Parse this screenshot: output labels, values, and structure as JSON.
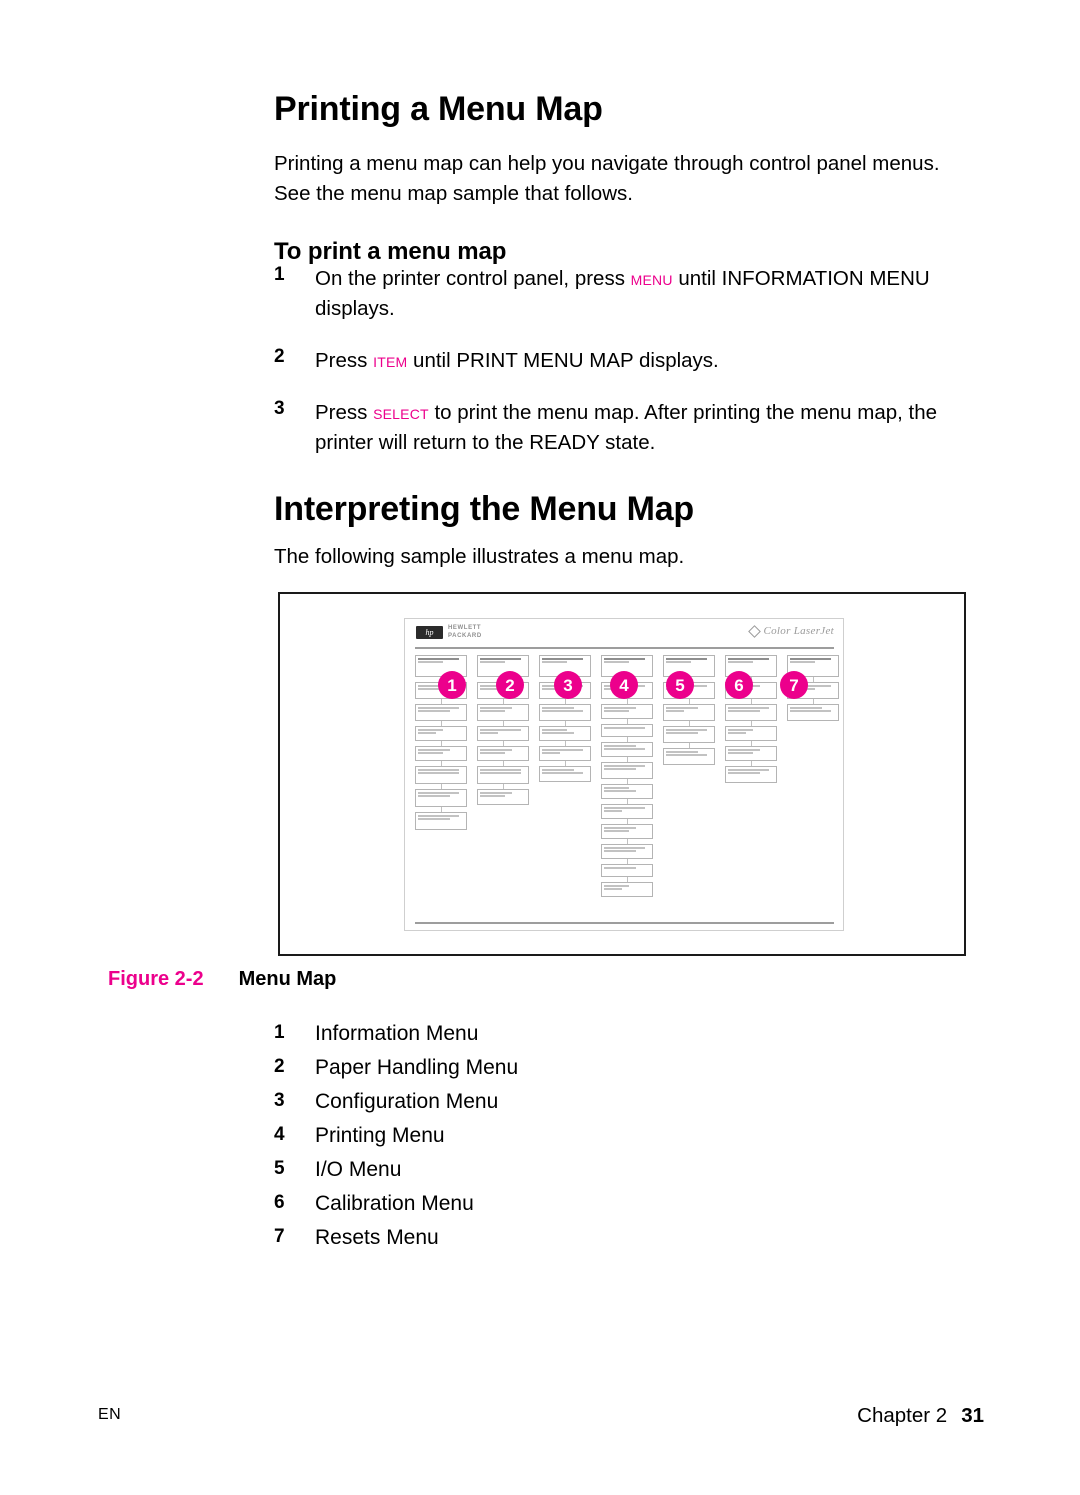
{
  "document": {
    "section1": {
      "heading": "Printing a Menu Map",
      "intro": "Printing a menu map can help you navigate through control panel menus. See the menu map sample that follows.",
      "subheading": "To print a menu map",
      "steps": [
        {
          "num": "1",
          "pre": "On the printer control panel, press ",
          "key": "MENU",
          "post": " until INFORMATION MENU displays."
        },
        {
          "num": "2",
          "pre": "Press ",
          "key": "ITEM",
          "post": " until PRINT MENU MAP displays."
        },
        {
          "num": "3",
          "pre": "Press ",
          "key": "SELECT",
          "post": " to print the menu map. After printing the menu map, the printer will return to the READY state."
        }
      ]
    },
    "section2": {
      "heading": "Interpreting the Menu Map",
      "intro": "The following sample illustrates a menu map."
    },
    "figure": {
      "number": "Figure 2-2",
      "title": "Menu Map",
      "sample_page": {
        "brand_logo": "hp-logo",
        "brand_text": "HEWLETT\nPACKARD",
        "product_mark": "Color LaserJet",
        "callouts": [
          "1",
          "2",
          "3",
          "4",
          "5",
          "6",
          "7"
        ]
      }
    },
    "legend": [
      {
        "num": "1",
        "label": "Information Menu"
      },
      {
        "num": "2",
        "label": "Paper Handling Menu"
      },
      {
        "num": "3",
        "label": "Configuration Menu"
      },
      {
        "num": "4",
        "label": "Printing Menu"
      },
      {
        "num": "5",
        "label": "I/O Menu"
      },
      {
        "num": "6",
        "label": "Calibration Menu"
      },
      {
        "num": "7",
        "label": "Resets Menu"
      }
    ],
    "footer": {
      "locale": "EN",
      "chapter": "Chapter 2",
      "page": "31"
    },
    "colors": {
      "accent_magenta": "#EC008C",
      "text_black": "#000000",
      "frame_border": "#1a1a1a"
    }
  }
}
